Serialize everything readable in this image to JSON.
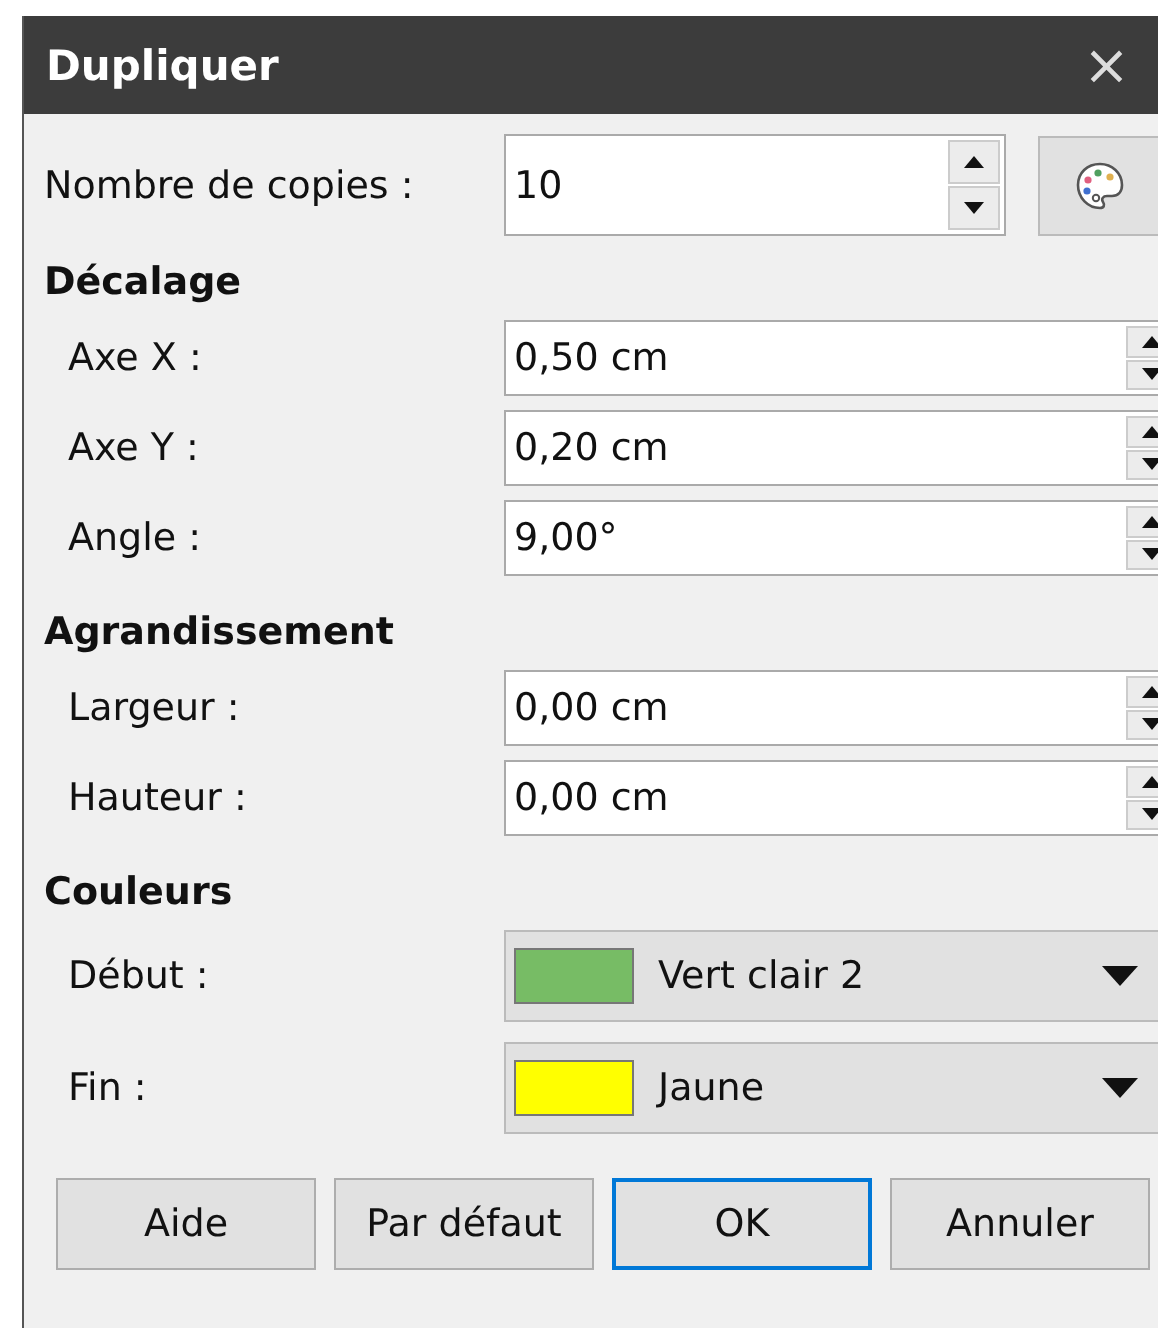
{
  "window": {
    "title": "Dupliquer",
    "close": "×"
  },
  "copies": {
    "label": "Nombre de copies :",
    "value": "10"
  },
  "sections": [
    {
      "title": "Décalage",
      "kind": "spin",
      "rows": [
        {
          "label": "Axe X :",
          "value": "0,50 cm"
        },
        {
          "label": "Axe Y :",
          "value": "0,20 cm"
        },
        {
          "label": "Angle :",
          "value": "9,00°"
        }
      ]
    },
    {
      "title": "Agrandissement",
      "kind": "spin",
      "rows": [
        {
          "label": "Largeur :",
          "value": "0,00 cm"
        },
        {
          "label": "Hauteur :",
          "value": "0,00 cm"
        }
      ]
    },
    {
      "title": "Couleurs",
      "kind": "color",
      "rows": [
        {
          "label": "Début :",
          "value": "Vert clair 2",
          "color": "#77bc65"
        },
        {
          "label": "Fin :",
          "value": "Jaune",
          "color": "#ffff00"
        }
      ]
    }
  ],
  "buttons": [
    {
      "label": "Aide",
      "default": false
    },
    {
      "label": "Par défaut",
      "default": false
    },
    {
      "label": "OK",
      "default": true
    },
    {
      "label": "Annuler",
      "default": false
    }
  ]
}
